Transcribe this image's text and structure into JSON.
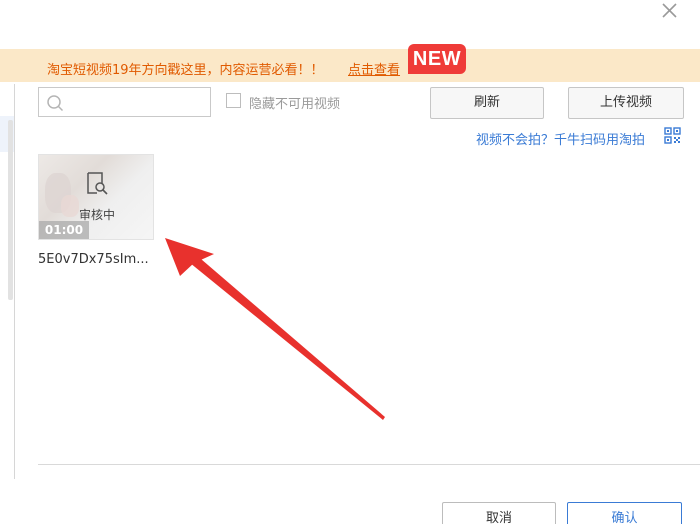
{
  "banner": {
    "text": "淘宝短视频19年方向戳这里，内容运营必看！！",
    "link_label": "点击查看",
    "badge": "NEW"
  },
  "toolbar": {
    "search_placeholder": "",
    "hide_unavailable_label": "隐藏不可用视频",
    "refresh_label": "刷新",
    "upload_label": "上传视频",
    "tip_link": "视频不会拍？千牛扫码用淘拍"
  },
  "videos": [
    {
      "status": "审核中",
      "duration": "01:00",
      "name": "5E0v7Dx75sIm..."
    }
  ],
  "footer": {
    "cancel_label": "取消",
    "confirm_label": "确认"
  },
  "colors": {
    "banner_bg": "#fbe8c8",
    "banner_text": "#e05a00",
    "badge": "#ef3b38",
    "link_blue": "#3a7bd5",
    "arrow_red": "#e8312d"
  },
  "icons": [
    "close-icon",
    "search-icon",
    "qr-code-icon",
    "review-icon",
    "annotation-arrow"
  ]
}
